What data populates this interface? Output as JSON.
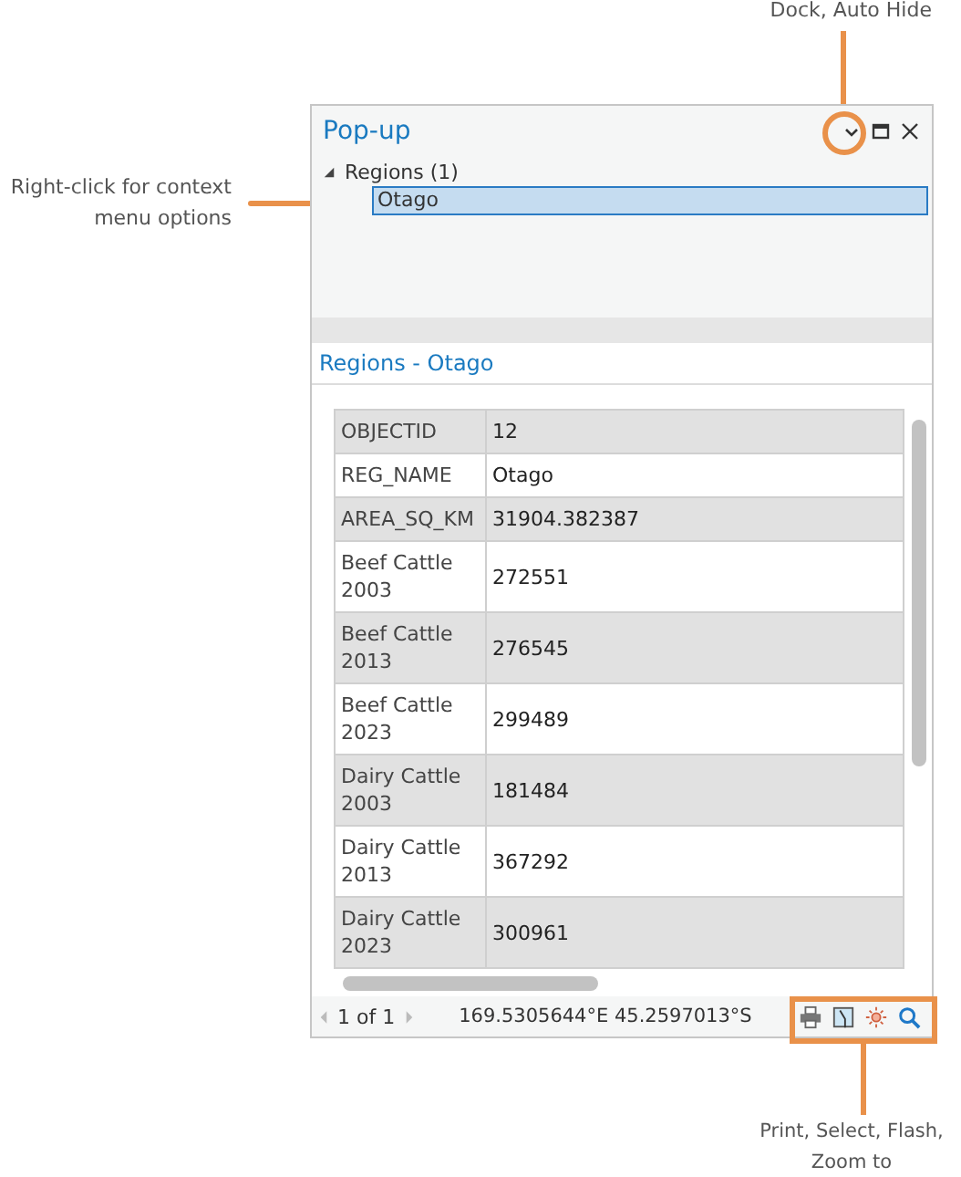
{
  "callouts": {
    "dock": "Dock, Auto Hide",
    "context": "Right-click for context menu options",
    "tools": "Print, Select, Flash, Zoom to"
  },
  "pane": {
    "title": "Pop-up"
  },
  "tree": {
    "label": "Regions (1)",
    "expanded": true,
    "children": [
      {
        "label": "Otago",
        "selected": true
      }
    ]
  },
  "feature_title": "Regions - Otago",
  "table": {
    "rows": [
      {
        "field": "OBJECTID",
        "value": "12"
      },
      {
        "field": "REG_NAME",
        "value": "Otago"
      },
      {
        "field": "AREA_SQ_KM",
        "value": "31904.382387"
      },
      {
        "field": "Beef Cattle 2003",
        "value": "272551"
      },
      {
        "field": "Beef Cattle 2013",
        "value": "276545"
      },
      {
        "field": "Beef Cattle 2023",
        "value": "299489"
      },
      {
        "field": "Dairy Cattle 2003",
        "value": "181484"
      },
      {
        "field": "Dairy Cattle 2013",
        "value": "367292"
      },
      {
        "field": "Dairy Cattle 2023",
        "value": "300961"
      }
    ]
  },
  "footer": {
    "page": "1 of 1",
    "coordinates": "169.5305644°E 45.2597013°S"
  }
}
